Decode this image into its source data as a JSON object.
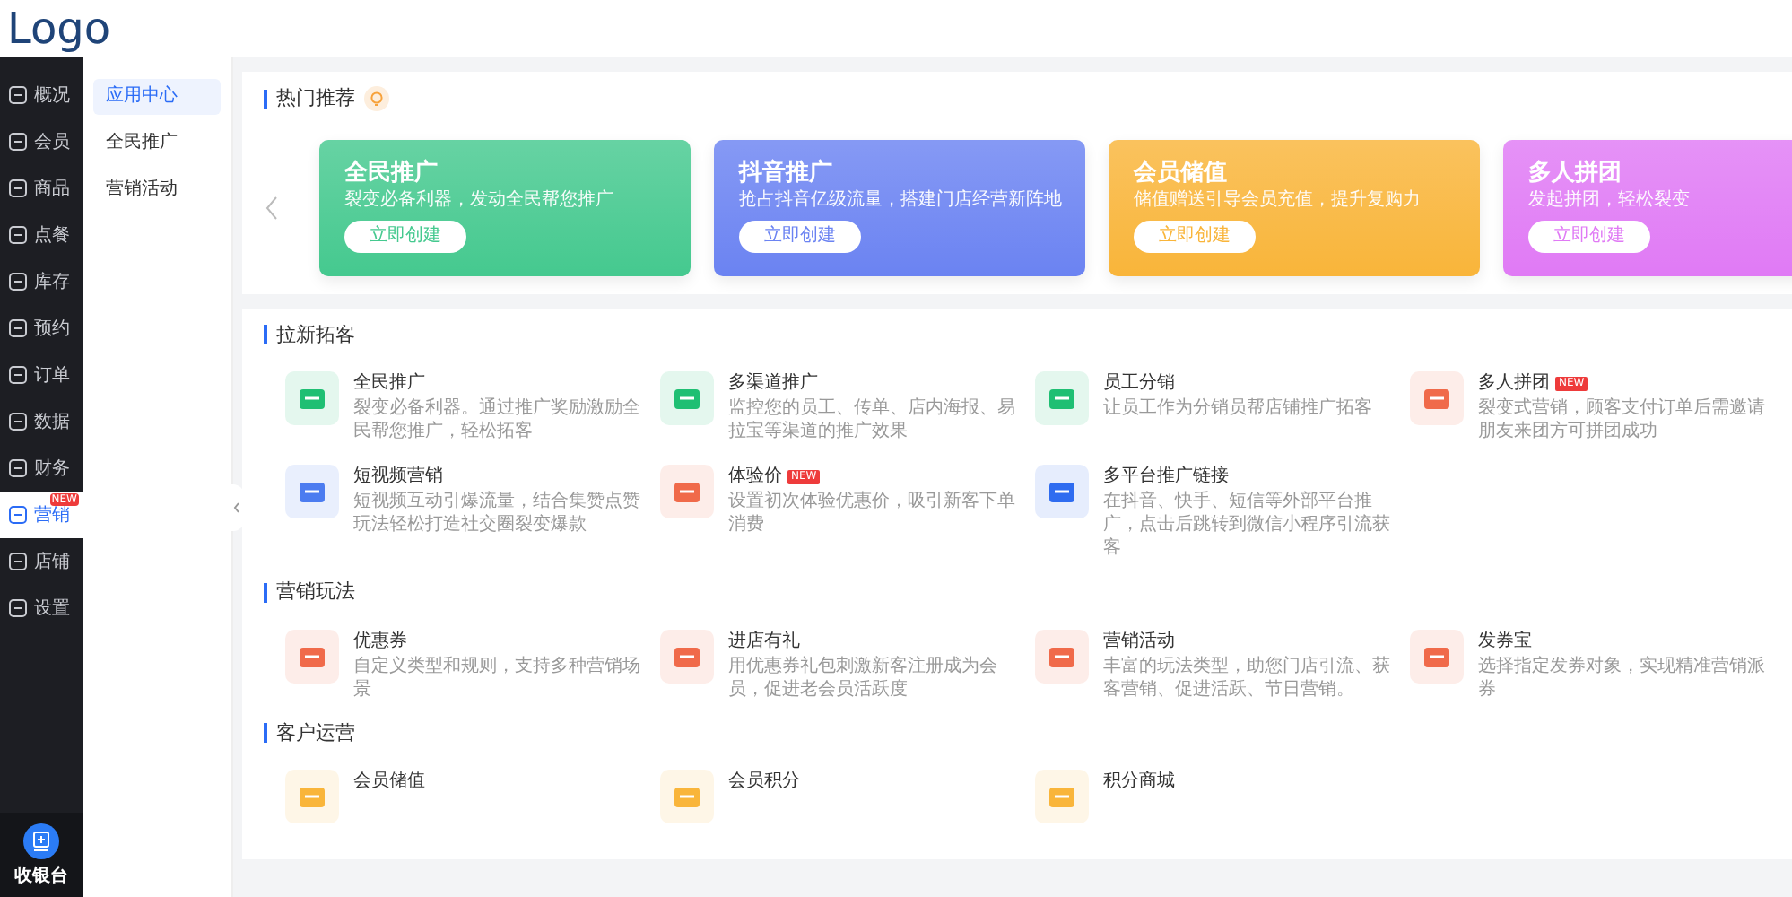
{
  "logo": "Logo",
  "sidebar": {
    "items": [
      {
        "label": "概况",
        "selected": false
      },
      {
        "label": "会员",
        "selected": false
      },
      {
        "label": "商品",
        "selected": false
      },
      {
        "label": "点餐",
        "selected": false
      },
      {
        "label": "库存",
        "selected": false
      },
      {
        "label": "预约",
        "selected": false
      },
      {
        "label": "订单",
        "selected": false
      },
      {
        "label": "数据",
        "selected": false
      },
      {
        "label": "财务",
        "selected": false
      },
      {
        "label": "营销",
        "selected": true,
        "badge": "NEW"
      },
      {
        "label": "店铺",
        "selected": false
      },
      {
        "label": "设置",
        "selected": false
      }
    ],
    "footer": {
      "label": "收银台"
    }
  },
  "subnav": {
    "items": [
      {
        "label": "应用中心",
        "selected": true
      },
      {
        "label": "全民推广",
        "selected": false
      },
      {
        "label": "营销活动",
        "selected": false
      }
    ]
  },
  "hot": {
    "title": "热门推荐",
    "cards": [
      {
        "title": "全民推广",
        "description": "裂变必备利器，发动全民帮您推广",
        "button": "立即创建",
        "color": "#45c98f"
      },
      {
        "title": "抖音推广",
        "description": "抢占抖音亿级流量，搭建门店经营新阵地",
        "button": "立即创建",
        "color": "#6b83f2"
      },
      {
        "title": "会员储值",
        "description": "储值赠送引导会员充值，提升复购力",
        "button": "立即创建",
        "color": "#f9b53a"
      },
      {
        "title": "多人拼团",
        "description": "发起拼团，轻松裂变",
        "button": "立即创建",
        "color": "#e07af5"
      }
    ]
  },
  "sections": [
    {
      "title": "拉新拓客",
      "items": [
        {
          "title": "全民推广",
          "description": "裂变必备利器。通过推广奖励激励全民帮您推广，轻松拓客",
          "color": "#1fbf73"
        },
        {
          "title": "多渠道推广",
          "description": "监控您的员工、传单、店内海报、易拉宝等渠道的推广效果",
          "color": "#1fbf73"
        },
        {
          "title": "员工分销",
          "description": "让员工作为分销员帮店铺推广拓客",
          "color": "#1fbf73"
        },
        {
          "title": "多人拼团",
          "description": "裂变式营销，顾客支付订单后需邀请朋友来团方可拼团成功",
          "color": "#f06a4a",
          "badge": "NEW"
        },
        {
          "title": "短视频营销",
          "description": "短视频互动引爆流量，结合集赞点赞玩法轻松打造社交圈裂变爆款",
          "color": "#4c7cf0"
        },
        {
          "title": "体验价",
          "description": "设置初次体验优惠价，吸引新客下单消费",
          "color": "#f06a4a",
          "badge": "NEW"
        },
        {
          "title": "多平台推广链接",
          "description": "在抖音、快手、短信等外部平台推广，点击后跳转到微信小程序引流获客",
          "color": "#2f6cf0"
        }
      ]
    },
    {
      "title": "营销玩法",
      "items": [
        {
          "title": "优惠券",
          "description": "自定义类型和规则，支持多种营销场景",
          "color": "#f06a4a"
        },
        {
          "title": "进店有礼",
          "description": "用优惠券礼包刺激新客注册成为会员，促进老会员活跃度",
          "color": "#f06a4a"
        },
        {
          "title": "营销活动",
          "description": "丰富的玩法类型，助您门店引流、获客营销、促进活跃、节日营销。",
          "color": "#f06a4a"
        },
        {
          "title": "发券宝",
          "description": "选择指定发券对象，实现精准营销派券",
          "color": "#f06a4a"
        }
      ]
    },
    {
      "title": "客户运营",
      "items": [
        {
          "title": "会员储值",
          "color": "#f9b53a"
        },
        {
          "title": "会员积分",
          "color": "#f9b53a"
        },
        {
          "title": "积分商城",
          "color": "#f9b53a"
        }
      ]
    }
  ]
}
